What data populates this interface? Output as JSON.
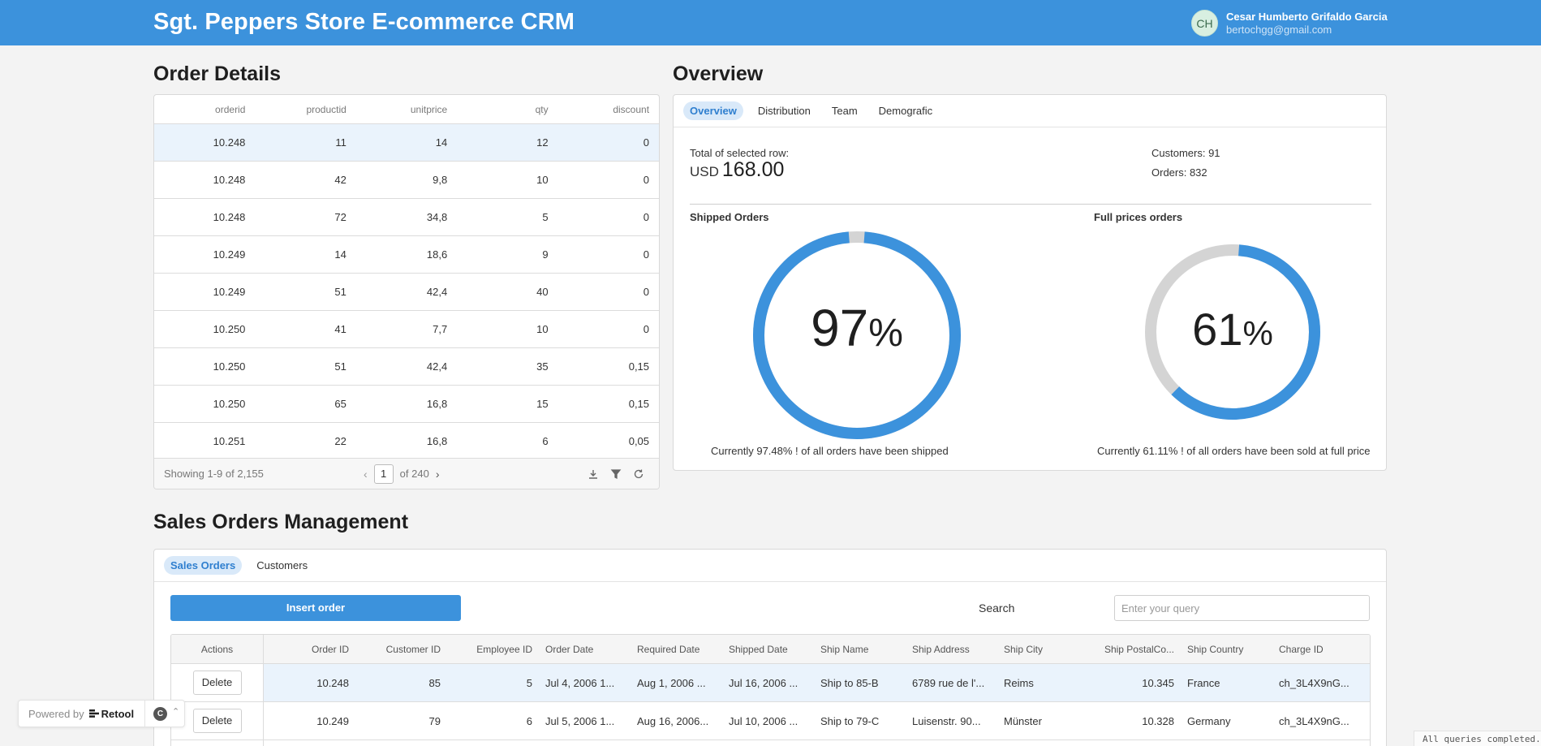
{
  "header": {
    "title": "Sgt. Peppers Store E-commerce CRM",
    "user": {
      "initials": "CH",
      "name": "Cesar Humberto Grifaldo Garcia",
      "email": "bertochgg@gmail.com"
    }
  },
  "order_details": {
    "title": "Order Details",
    "columns": [
      "orderid",
      "productid",
      "unitprice",
      "qty",
      "discount"
    ],
    "rows": [
      [
        "10.248",
        "11",
        "14",
        "12",
        "0"
      ],
      [
        "10.248",
        "42",
        "9,8",
        "10",
        "0"
      ],
      [
        "10.248",
        "72",
        "34,8",
        "5",
        "0"
      ],
      [
        "10.249",
        "14",
        "18,6",
        "9",
        "0"
      ],
      [
        "10.249",
        "51",
        "42,4",
        "40",
        "0"
      ],
      [
        "10.250",
        "41",
        "7,7",
        "10",
        "0"
      ],
      [
        "10.250",
        "51",
        "42,4",
        "35",
        "0,15"
      ],
      [
        "10.250",
        "65",
        "16,8",
        "15",
        "0,15"
      ],
      [
        "10.251",
        "22",
        "16,8",
        "6",
        "0,05"
      ]
    ],
    "footer": {
      "showing": "Showing 1-9 of 2,155",
      "page": "1",
      "of_pages": "of 240"
    }
  },
  "overview": {
    "title": "Overview",
    "tabs": [
      "Overview",
      "Distribution",
      "Team",
      "Demografic"
    ],
    "active_tab": "Overview",
    "total_label": "Total of selected row:",
    "currency": "USD",
    "total_value": "168.00",
    "customers": "Customers: 91",
    "orders": "Orders: 832",
    "shipped": {
      "title": "Shipped Orders",
      "percent_label": "97",
      "percent_sign": "%",
      "fraction": 0.9748,
      "caption": "Currently 97.48% ! of all orders have been shipped"
    },
    "full_price": {
      "title": "Full prices orders",
      "percent_label": "61",
      "percent_sign": "%",
      "fraction": 0.6111,
      "caption": "Currently 61.11% ! of all orders have been sold at full price"
    },
    "colors": {
      "ring": "#3c92dc",
      "track": "#d4d4d4"
    }
  },
  "sales": {
    "title": "Sales Orders Management",
    "tabs": [
      "Sales Orders",
      "Customers"
    ],
    "active_tab": "Sales Orders",
    "insert_label": "Insert order",
    "search_label": "Search",
    "search_placeholder": "Enter your query",
    "columns": [
      "Actions",
      "Order ID",
      "Customer ID",
      "Employee ID",
      "Order Date",
      "Required Date",
      "Shipped Date",
      "Ship Name",
      "Ship Address",
      "Ship City",
      "Ship PostalCo...",
      "Ship Country",
      "Charge ID"
    ],
    "delete_label": "Delete",
    "rows": [
      [
        "10.248",
        "85",
        "5",
        "Jul 4, 2006 1...",
        "Aug 1, 2006 ...",
        "Jul 16, 2006 ...",
        "Ship to 85-B",
        "6789 rue de l'...",
        "Reims",
        "10.345",
        "France",
        "ch_3L4X9nG..."
      ],
      [
        "10.249",
        "79",
        "6",
        "Jul 5, 2006 1...",
        "Aug 16, 2006...",
        "Jul 10, 2006 ...",
        "Ship to 79-C",
        "Luisenstr. 90...",
        "Münster",
        "10.328",
        "Germany",
        "ch_3L4X9nG..."
      ]
    ]
  },
  "powered_by": {
    "prefix": "Powered by",
    "brand": "Retool",
    "badge": "C"
  },
  "status_text": "All queries completed.",
  "colors": {
    "header": "#3c92dc",
    "accent": "#3c92dc",
    "background": "#f3f3f3"
  }
}
